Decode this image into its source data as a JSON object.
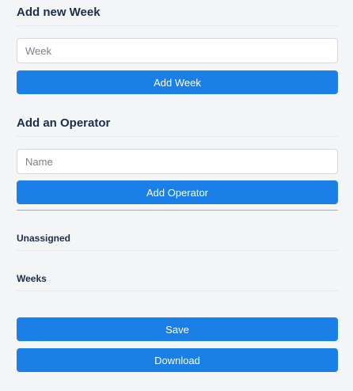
{
  "week_section": {
    "title": "Add new Week",
    "input_placeholder": "Week",
    "input_value": "",
    "button_label": "Add Week"
  },
  "operator_section": {
    "title": "Add an Operator",
    "input_placeholder": "Name",
    "input_value": "",
    "button_label": "Add Operator"
  },
  "lists": {
    "unassigned_title": "Unassigned",
    "weeks_title": "Weeks"
  },
  "actions": {
    "save_label": "Save",
    "download_label": "Download"
  },
  "colors": {
    "primary_button": "#1a7fe6",
    "heading_text": "#1b2f4a",
    "background": "#f4f5f7"
  }
}
